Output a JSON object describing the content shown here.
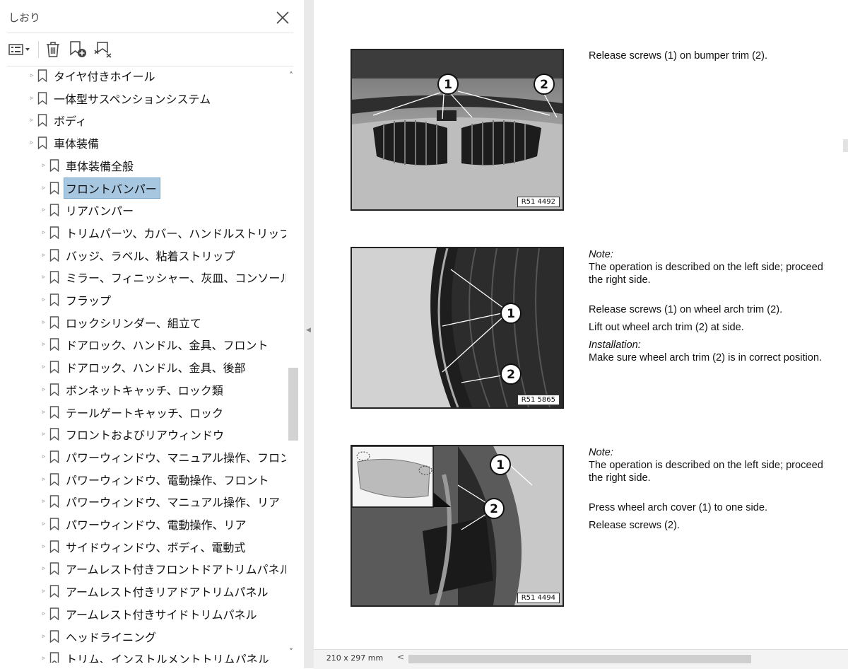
{
  "sidebar": {
    "title": "しおり",
    "toolbar": {
      "options": "options-menu",
      "delete": "delete",
      "add_bookmark": "add-bookmark",
      "expand_bookmark": "expand-current-bookmark"
    },
    "items": [
      {
        "label": "タイヤ付きホイール",
        "level": 1
      },
      {
        "label": "一体型サスペンションシステム",
        "level": 1
      },
      {
        "label": "ボディ",
        "level": 1
      },
      {
        "label": "車体装備",
        "level": 1
      },
      {
        "label": "車体装備全般",
        "level": 2
      },
      {
        "label": "フロントバンパー",
        "level": 2,
        "selected": true
      },
      {
        "label": "リアバンパー",
        "level": 2
      },
      {
        "label": "トリムパーツ、カバー、ハンドルストリップ",
        "level": 2
      },
      {
        "label": "バッジ、ラベル、粘着ストリップ",
        "level": 2
      },
      {
        "label": "ミラー、フィニッシャー、灰皿、コンソール",
        "level": 2
      },
      {
        "label": "フラップ",
        "level": 2
      },
      {
        "label": "ロックシリンダー、組立て",
        "level": 2
      },
      {
        "label": "ドアロック、ハンドル、金具、フロント",
        "level": 2
      },
      {
        "label": "ドアロック、ハンドル、金具、後部",
        "level": 2
      },
      {
        "label": "ボンネットキャッチ、ロック類",
        "level": 2
      },
      {
        "label": "テールゲートキャッチ、ロック",
        "level": 2
      },
      {
        "label": "フロントおよびリアウィンドウ",
        "level": 2
      },
      {
        "label": "パワーウィンドウ、マニュアル操作、フロント",
        "level": 2
      },
      {
        "label": "パワーウィンドウ、電動操作、フロント",
        "level": 2
      },
      {
        "label": "パワーウィンドウ、マニュアル操作、リア",
        "level": 2
      },
      {
        "label": "パワーウィンドウ、電動操作、リア",
        "level": 2
      },
      {
        "label": "サイドウィンドウ、ボディ、電動式",
        "level": 2
      },
      {
        "label": "アームレスト付きフロントドアトリムパネル",
        "level": 2
      },
      {
        "label": "アームレスト付きリアドアトリムパネル",
        "level": 2
      },
      {
        "label": "アームレスト付きサイドトリムパネル",
        "level": 2
      },
      {
        "label": "ヘッドライニング",
        "level": 2
      },
      {
        "label": "トリム、インストルメントトリムパネル",
        "level": 2
      }
    ]
  },
  "document": {
    "figures": [
      {
        "code": "R51 4492",
        "callouts": [
          "1",
          "2"
        ]
      },
      {
        "code": "R51 5865",
        "callouts": [
          "1",
          "2"
        ]
      },
      {
        "code": "R51 4494",
        "callouts": [
          "1",
          "2"
        ]
      }
    ],
    "block1": {
      "line1": "Release screws (1) on bumper trim (2)."
    },
    "block2": {
      "note_label": "Note:",
      "note_line1": "The operation is described on the left side; proceed",
      "note_line2": "the right side.",
      "step1": "Release screws (1) on wheel arch trim (2).",
      "step2": "Lift out wheel arch trim (2) at side.",
      "install_label": "Installation:",
      "install_text": "Make sure wheel arch trim (2) is in correct position."
    },
    "block3": {
      "note_label": "Note:",
      "note_line1": "The operation is described on the left side; proceed",
      "note_line2": "the right side.",
      "step1": "Press wheel arch cover (1) to one side.",
      "step2": "Release screws (2)."
    }
  },
  "statusbar": {
    "page_size": "210 x 297 mm"
  },
  "colors": {
    "selection": "#a7c7e0",
    "selection_border": "#7aa8cc"
  }
}
